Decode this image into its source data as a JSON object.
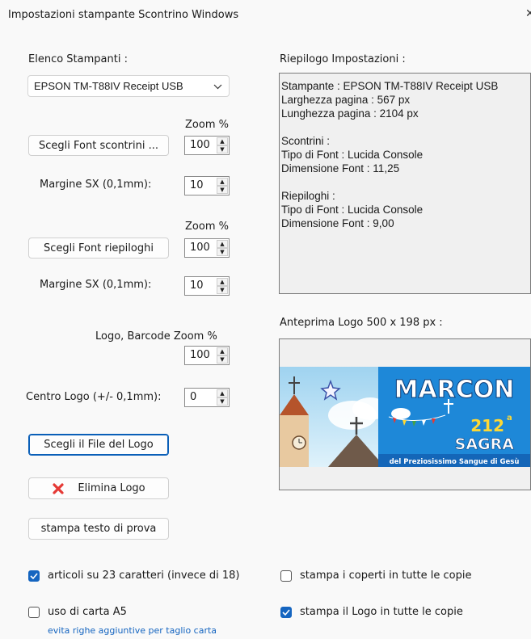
{
  "window": {
    "title": "Impostazioni stampante Scontrino Windows",
    "close_glyph": "✕"
  },
  "printers": {
    "label": "Elenco Stampanti :",
    "selected": "EPSON TM-T88IV Receipt USB"
  },
  "receipt_font": {
    "zoom_label": "Zoom %",
    "button": "Scegli Font scontrini ...",
    "zoom_value": "100",
    "margin_label": "Margine SX (0,1mm):",
    "margin_value": "10"
  },
  "summary_font": {
    "zoom_label": "Zoom %",
    "button": "Scegli Font riepiloghi",
    "zoom_value": "100",
    "margin_label": "Margine SX (0,1mm):",
    "margin_value": "10"
  },
  "logo": {
    "zoom_label": "Logo, Barcode Zoom %",
    "zoom_value": "100",
    "center_label": "Centro Logo (+/- 0,1mm):",
    "center_value": "0",
    "choose_button": "Scegli il File del Logo",
    "delete_button": "Elimina Logo",
    "test_button": "stampa testo di prova"
  },
  "summary_panel": {
    "label": "Riepilogo Impostazioni :",
    "lines": [
      "Stampante : EPSON TM-T88IV Receipt USB",
      "Larghezza pagina : 567 px",
      "Lunghezza pagina : 2104 px",
      "",
      "Scontrini :",
      "Tipo di Font : Lucida Console",
      "Dimensione Font : 11,25",
      "",
      "Riepiloghi :",
      "Tipo di Font : Lucida Console",
      "Dimensione Font : 9,00"
    ]
  },
  "preview": {
    "label": "Anteprima Logo 500 x 198 px :",
    "logo_title": "MARCON",
    "logo_number": "212",
    "logo_sup": "a",
    "logo_sagra": "SAGRA",
    "logo_footer": "del Preziosissimo Sangue di Gesù"
  },
  "options": {
    "chars23": {
      "label": "articoli su 23 caratteri (invece di 18)",
      "checked": true
    },
    "a5": {
      "label": "uso di carta A5",
      "checked": false,
      "hint": "evita righe aggiuntive per taglio carta"
    },
    "covers": {
      "label": "stampa i coperti in tutte le copie",
      "checked": false
    },
    "logo_all": {
      "label": "stampa il Logo in tutte le copie",
      "checked": true
    }
  },
  "colors": {
    "accent": "#1565c0",
    "delete_icon": "#e53935",
    "logo_blue": "#1e88d8"
  }
}
